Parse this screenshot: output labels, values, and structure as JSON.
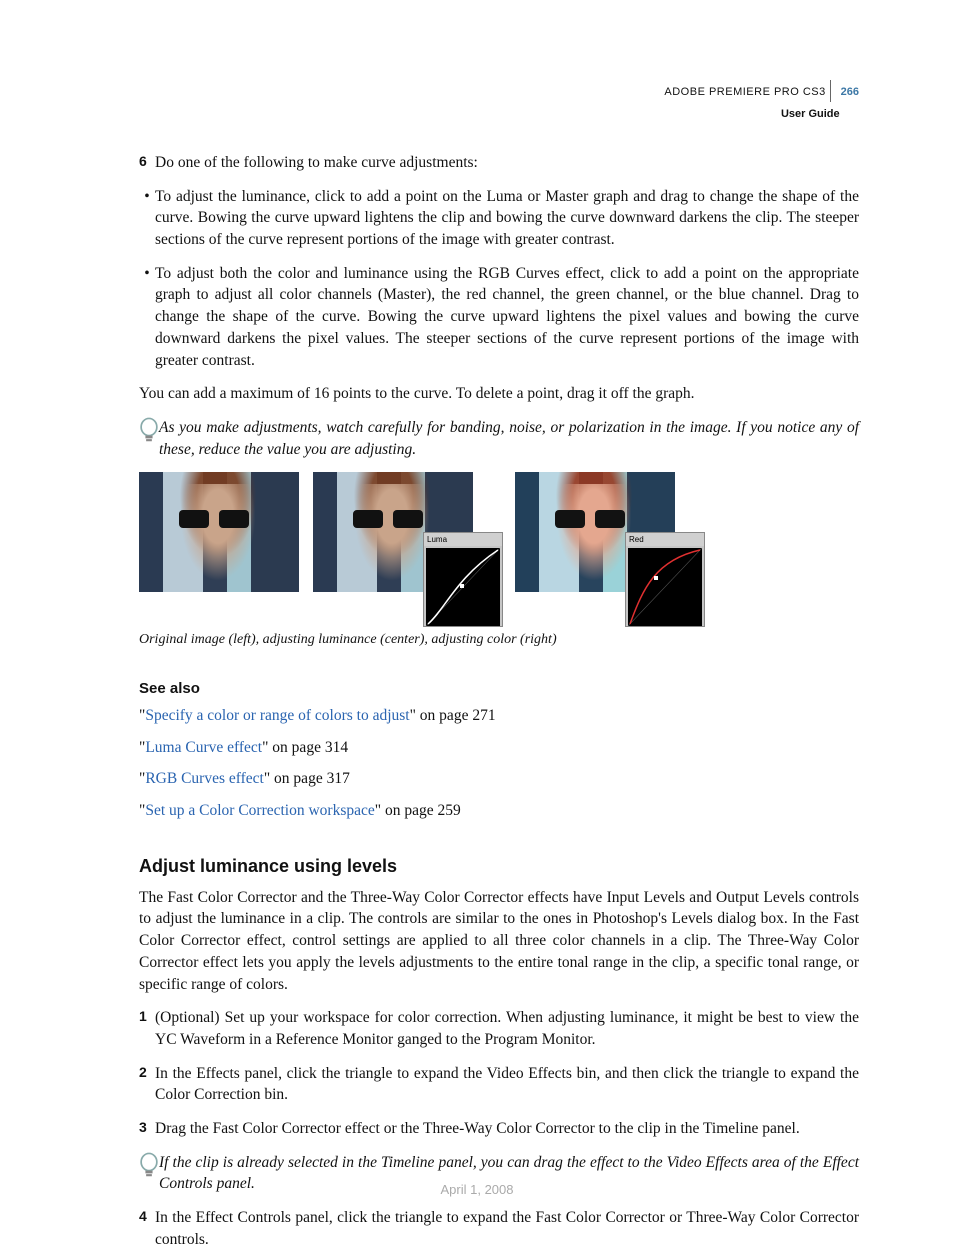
{
  "header": {
    "product": "ADOBE PREMIERE PRO CS3",
    "subtitle": "User Guide",
    "page_number": "266"
  },
  "steps_top": {
    "step6_num": "6",
    "step6_text": "Do one of the following to make curve adjustments:",
    "bullet1": "To adjust the luminance, click to add a point on the Luma or Master graph and drag to change the shape of the curve. Bowing the curve upward lightens the clip and bowing the curve downward darkens the clip. The steeper sections of the curve represent portions of the image with greater contrast.",
    "bullet2": "To adjust both the color and luminance using the RGB Curves effect, click to add a point on the appropriate graph to adjust all color channels (Master), the red channel, the green channel, or the blue channel. Drag to change the shape of the curve. Bowing the curve upward lightens the pixel values and bowing the curve downward darkens the pixel values. The steeper sections of the curve represent portions of the image with greater contrast."
  },
  "para_max_points": "You can add a maximum of 16 points to the curve. To delete a point, drag it off the graph.",
  "tip1": "As you make adjustments, watch carefully for banding, noise, or polarization in the image. If you notice any of these, reduce the value you are adjusting.",
  "figure": {
    "curve_label_luma": "Luma",
    "curve_label_red": "Red",
    "caption": "Original image (left), adjusting luminance (center), adjusting color (right)"
  },
  "see_also": {
    "heading": "See also",
    "items": [
      {
        "link": "Specify a color or range of colors to adjust",
        "suffix": "\" on page 271"
      },
      {
        "link": "Luma Curve effect",
        "suffix": "\" on page 314"
      },
      {
        "link": "RGB Curves effect",
        "suffix": "\" on page 317"
      },
      {
        "link": "Set up a Color Correction workspace",
        "suffix": "\" on page 259"
      }
    ]
  },
  "section2": {
    "title": "Adjust luminance using levels",
    "intro": "The Fast Color Corrector and the Three-Way Color Corrector effects have Input Levels and Output Levels controls to adjust the luminance in a clip. The controls are similar to the ones in Photoshop's Levels dialog box. In the Fast Color Corrector effect, control settings are applied to all three color channels in a clip. The Three-Way Color Corrector effect lets you apply the levels adjustments to the entire tonal range in the clip, a specific tonal range, or specific range of colors.",
    "step1_num": "1",
    "step1_text": "(Optional) Set up your workspace for color correction. When adjusting luminance, it might be best to view the YC Waveform in a Reference Monitor ganged to the Program Monitor.",
    "step2_num": "2",
    "step2_text": "In the Effects panel, click the triangle to expand the Video Effects bin, and then click the triangle to expand the Color Correction bin.",
    "step3_num": "3",
    "step3_text": "Drag the Fast Color Corrector effect or the Three-Way Color Corrector to the clip in the Timeline panel.",
    "tip2": "If the clip is already selected in the Timeline panel, you can drag the effect to the Video Effects area of the Effect Controls panel.",
    "step4_num": "4",
    "step4_text": "In the Effect Controls panel, click the triangle to expand the Fast Color Corrector or Three-Way Color Corrector controls."
  },
  "footer_date": "April 1, 2008"
}
